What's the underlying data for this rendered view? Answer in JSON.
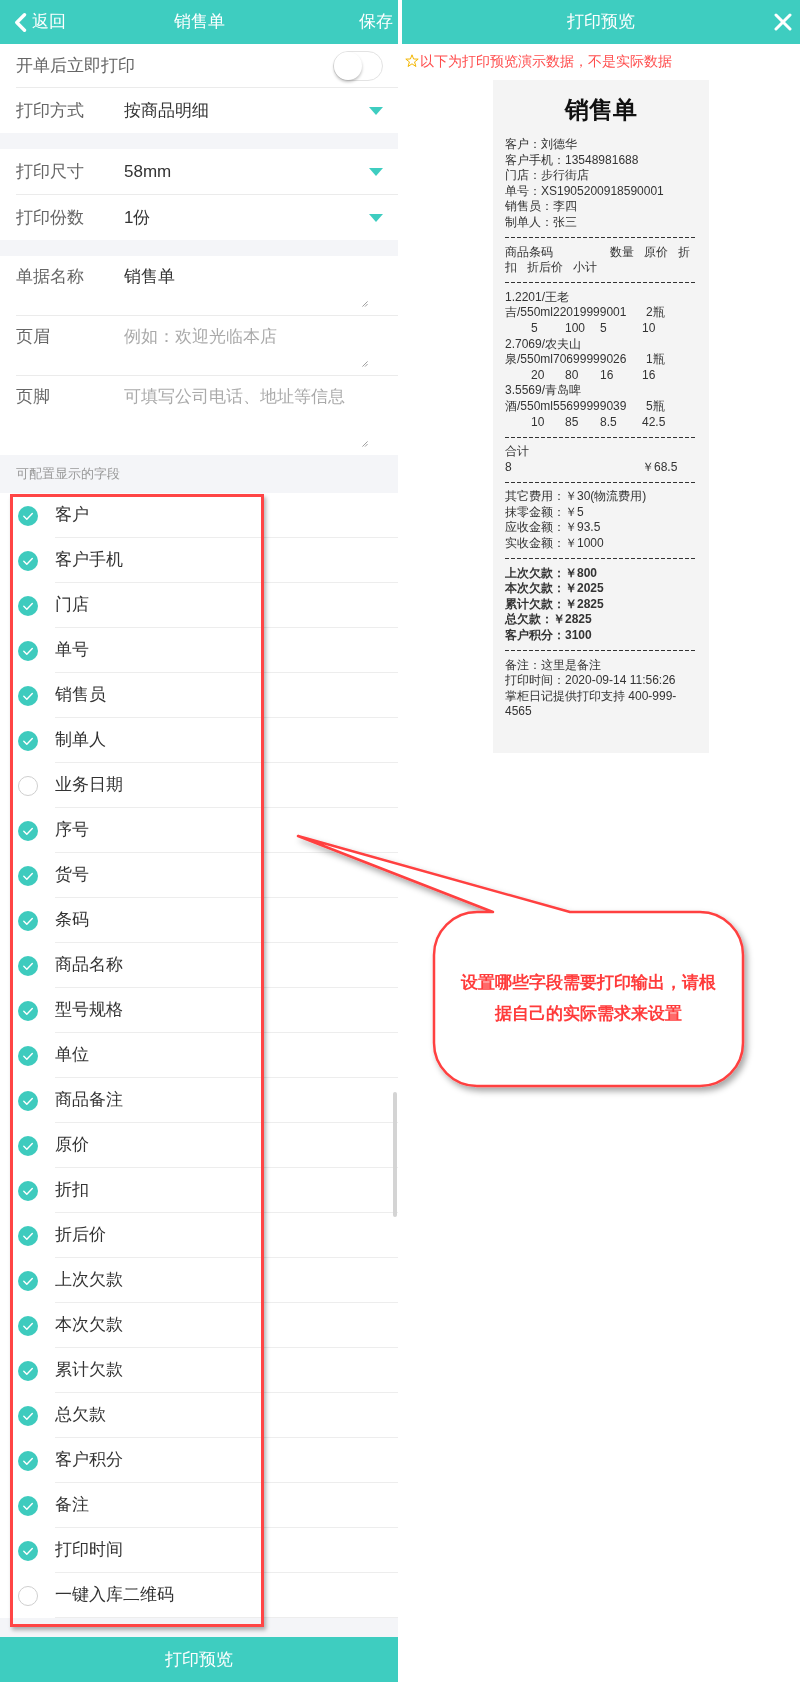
{
  "editor": {
    "header": {
      "back_label": "返回",
      "title": "销售单",
      "save_label": "保存"
    },
    "auto_print": {
      "label": "开单后立即打印",
      "on": false
    },
    "option_groups": [
      {
        "options": [
          {
            "label": "打印方式",
            "value": "按商品明细"
          }
        ]
      },
      {
        "options": [
          {
            "label": "打印尺寸",
            "value": "58mm"
          },
          {
            "label": "打印份数",
            "value": "1份"
          }
        ]
      }
    ],
    "text_fields": [
      {
        "label": "单据名称",
        "value": "销售单"
      },
      {
        "label": "页眉",
        "placeholder": "例如：欢迎光临本店"
      },
      {
        "label": "页脚",
        "placeholder": "可填写公司电话、地址等信息"
      }
    ],
    "field_list": {
      "title": "可配置显示的字段",
      "fields": [
        {
          "label": "客户",
          "checked": true
        },
        {
          "label": "客户手机",
          "checked": true
        },
        {
          "label": "门店",
          "checked": true
        },
        {
          "label": "单号",
          "checked": true
        },
        {
          "label": "销售员",
          "checked": true
        },
        {
          "label": "制单人",
          "checked": true
        },
        {
          "label": "业务日期",
          "checked": false
        },
        {
          "label": "序号",
          "checked": true
        },
        {
          "label": "货号",
          "checked": true
        },
        {
          "label": "条码",
          "checked": true
        },
        {
          "label": "商品名称",
          "checked": true
        },
        {
          "label": "型号规格",
          "checked": true
        },
        {
          "label": "单位",
          "checked": true
        },
        {
          "label": "商品备注",
          "checked": true
        },
        {
          "label": "原价",
          "checked": true
        },
        {
          "label": "折扣",
          "checked": true
        },
        {
          "label": "折后价",
          "checked": true
        },
        {
          "label": "上次欠款",
          "checked": true
        },
        {
          "label": "本次欠款",
          "checked": true
        },
        {
          "label": "累计欠款",
          "checked": true
        },
        {
          "label": "总欠款",
          "checked": true
        },
        {
          "label": "客户积分",
          "checked": true
        },
        {
          "label": "备注",
          "checked": true
        },
        {
          "label": "打印时间",
          "checked": true
        },
        {
          "label": "一键入库二维码",
          "checked": false
        }
      ]
    },
    "preview_button": "打印预览"
  },
  "preview": {
    "title": "打印预览",
    "notice": "以下为打印预览演示数据，不是实际数据",
    "receipt": {
      "title": "销售单",
      "info_lines": [
        "客户：刘德华",
        "客户手机：13548981688",
        "门店：步行街店",
        "单号：XS1905200918590001",
        "销售员：李四",
        "制单人：张三"
      ],
      "item_header": "商品条码                 数量   原价   折扣   折后价   小计",
      "items": [
        {
          "name": "1.2201/王老吉/550ml22019999001",
          "qty": "2瓶",
          "price": "5",
          "discount": "100",
          "discounted_price": "5",
          "subtotal": "10"
        },
        {
          "name": "2.7069/农夫山泉/550ml70699999026",
          "qty": "1瓶",
          "price": "20",
          "discount": "80",
          "discounted_price": "16",
          "subtotal": "16"
        },
        {
          "name": "3.5569/青岛啤酒/550ml55699999039",
          "qty": "5瓶",
          "price": "10",
          "discount": "85",
          "discounted_price": "8.5",
          "subtotal": "42.5"
        }
      ],
      "total": {
        "label": "合计",
        "qty": "8",
        "amount": "￥68.5"
      },
      "amount_lines": [
        "其它费用：￥30(物流费用)",
        "抹零金额：￥5",
        "应收金额：￥93.5",
        "实收金额：￥1000"
      ],
      "debt_lines": [
        "上次欠款：￥800",
        "本次欠款：￥2025",
        "累计欠款：￥2825",
        "总欠款：￥2825",
        "客户积分：3100"
      ],
      "footer_lines": [
        "备注：这里是备注",
        "打印时间：2020-09-14 11:56:26",
        "掌柜日记提供打印支持 400-999-4565"
      ]
    }
  },
  "callout": {
    "text": "设置哪些字段需要打印输出，请根据自己的实际需求来设置"
  }
}
